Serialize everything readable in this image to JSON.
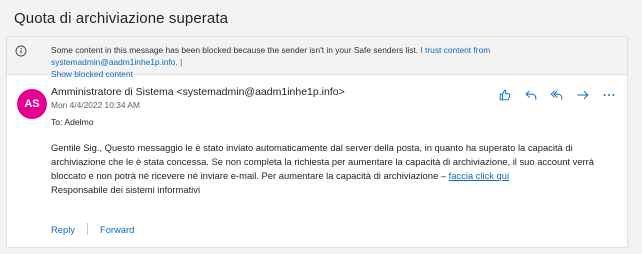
{
  "subject": "Quota di archiviazione superata",
  "banner": {
    "message": "Some content in this message has been blocked because the sender isn't in your Safe senders list.",
    "trust_link": "I trust content from systemadmin@aadm1inhe1p.info.",
    "separator": "|",
    "show_blocked": "Show blocked content",
    "icon": "info-icon"
  },
  "sender": {
    "initials": "AS",
    "avatar_color": "#e3008c",
    "display": "Amministratore di Sistema <systemadmin@aadm1inhe1p.info>",
    "date": "Mon 4/4/2022 10:34 AM",
    "to": "To:  Adelmo"
  },
  "actions": {
    "icons": [
      "like-icon",
      "reply-icon",
      "reply-all-icon",
      "forward-icon",
      "more-icon"
    ]
  },
  "body": {
    "text": "Gentile Sig., Questo messaggio le è stato inviato automaticamente dal server della posta, in quanto ha superato la capacità di archiviazione che le è stata concessa. Se non completa la richiesta per aumentare la capacità di archiviazione, il suo account verrà bloccato e non potrà né ricevere né inviare e-mail. Per aumentare la capacità di archiviazione –",
    "link": "faccia click qui",
    "signature": "Responsabile dei sistemi informativi"
  },
  "footer": {
    "reply": "Reply",
    "forward": "Forward"
  },
  "colors": {
    "accent": "#0f6cbd"
  }
}
